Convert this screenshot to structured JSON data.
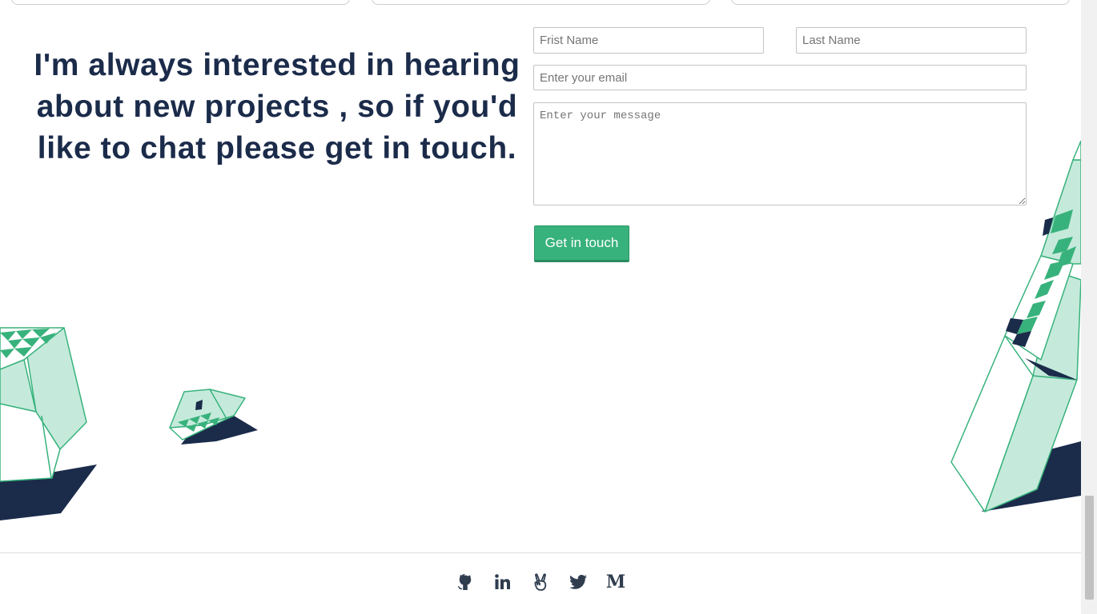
{
  "contact": {
    "headline": "I'm always interested in hearing about new projects , so if you'd like to chat please get in touch.",
    "first_name_placeholder": "Frist Name",
    "last_name_placeholder": "Last Name",
    "email_placeholder": "Enter your email",
    "message_placeholder": "Enter your message",
    "submit_label": "Get in touch"
  },
  "footer": {
    "medium_letter": "M",
    "social_icons": [
      "github-icon",
      "linkedin-icon",
      "angellist-icon",
      "twitter-icon",
      "medium-icon"
    ]
  },
  "colors": {
    "accent": "#38b27c",
    "navy": "#1b2b4a",
    "mint": "#c5eadb"
  }
}
